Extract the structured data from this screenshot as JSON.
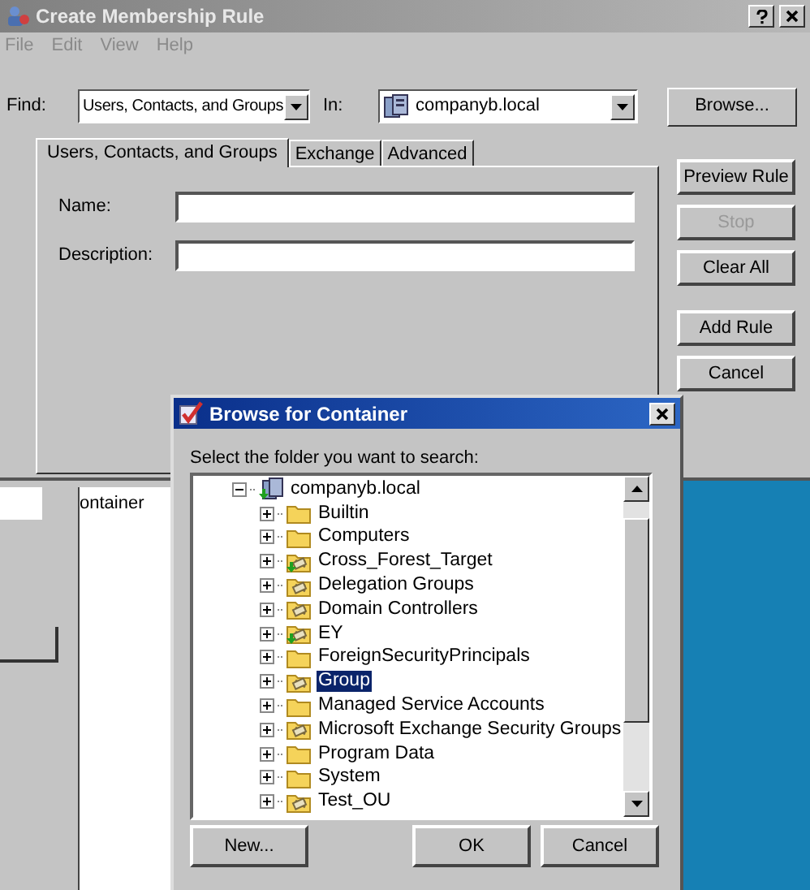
{
  "main_window": {
    "title": "Create Membership Rule",
    "menu": [
      "File",
      "Edit",
      "View",
      "Help"
    ],
    "find": {
      "label": "Find:",
      "value": "Users, Contacts, and Groups"
    },
    "in": {
      "label": "In:",
      "value": "companyb.local"
    },
    "browse_button": "Browse...",
    "tabs": [
      {
        "label": "Users, Contacts, and Groups",
        "selected": true
      },
      {
        "label": "Exchange",
        "selected": false
      },
      {
        "label": "Advanced",
        "selected": false
      }
    ],
    "fields": [
      {
        "label": "Name:"
      },
      {
        "label": "Description:"
      }
    ],
    "button_groups": [
      [
        {
          "label": "Preview Rule",
          "disabled": false
        },
        {
          "label": "Stop",
          "disabled": true
        },
        {
          "label": "Clear All",
          "disabled": false
        }
      ],
      [
        {
          "label": "Add Rule",
          "disabled": false
        },
        {
          "label": "Cancel",
          "disabled": false
        }
      ]
    ]
  },
  "background": {
    "column_header": "ontainer"
  },
  "dialog": {
    "title": "Browse for Container",
    "prompt": "Select the folder you want to search:",
    "tree": [
      {
        "label": "companyb.local",
        "kind": "domain",
        "expanded": true,
        "selected": false,
        "children": [
          {
            "label": "Builtin",
            "kind": "folder",
            "expanded": false,
            "selected": false
          },
          {
            "label": "Computers",
            "kind": "folder",
            "expanded": false,
            "selected": false
          },
          {
            "label": "Cross_Forest_Target",
            "kind": "linked-ou",
            "expanded": false,
            "selected": false
          },
          {
            "label": "Delegation Groups",
            "kind": "ou",
            "expanded": false,
            "selected": false
          },
          {
            "label": "Domain Controllers",
            "kind": "ou",
            "expanded": false,
            "selected": false
          },
          {
            "label": "EY",
            "kind": "linked-ou",
            "expanded": false,
            "selected": false
          },
          {
            "label": "ForeignSecurityPrincipals",
            "kind": "folder",
            "expanded": false,
            "selected": false
          },
          {
            "label": "Group",
            "kind": "ou",
            "expanded": false,
            "selected": true
          },
          {
            "label": "Managed Service Accounts",
            "kind": "folder",
            "expanded": false,
            "selected": false
          },
          {
            "label": "Microsoft Exchange Security Groups",
            "kind": "ou",
            "expanded": false,
            "selected": false
          },
          {
            "label": "Program Data",
            "kind": "folder",
            "expanded": false,
            "selected": false
          },
          {
            "label": "System",
            "kind": "folder",
            "expanded": false,
            "selected": false
          },
          {
            "label": "Test_OU",
            "kind": "ou",
            "expanded": false,
            "selected": false
          }
        ]
      }
    ],
    "buttons": [
      "New...",
      "OK",
      "Cancel"
    ]
  }
}
